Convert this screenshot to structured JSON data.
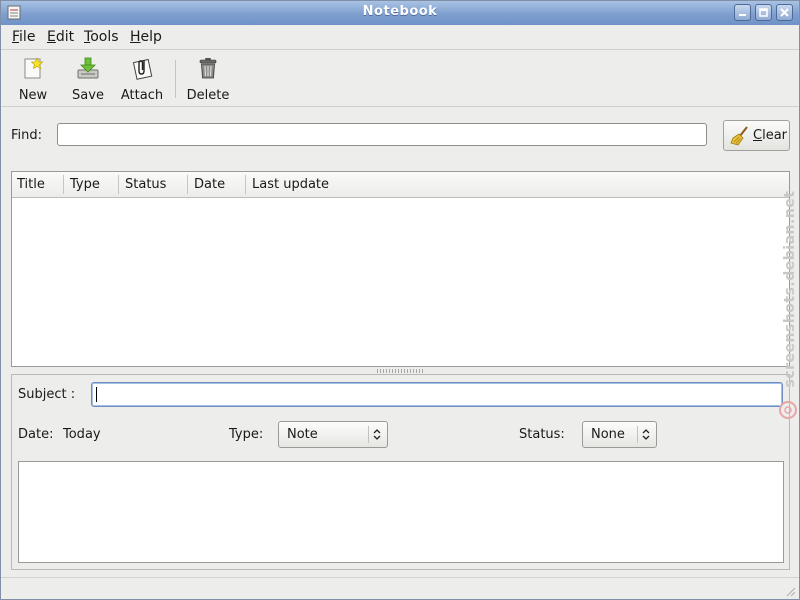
{
  "window": {
    "title": "Notebook",
    "icons": {
      "app": "notebook-app-icon",
      "minimize": "minimize-icon",
      "maximize": "maximize-icon",
      "close": "close-icon"
    }
  },
  "menu": {
    "file": {
      "mnemonic": "F",
      "rest": "ile"
    },
    "edit": {
      "mnemonic": "E",
      "rest": "dit"
    },
    "tools": {
      "mnemonic": "T",
      "rest": "ools"
    },
    "help": {
      "mnemonic": "H",
      "rest": "elp"
    }
  },
  "toolbar": {
    "new_label": "New",
    "save_label": "Save",
    "attach_label": "Attach",
    "delete_label": "Delete",
    "icons": {
      "new": "new-note-icon",
      "save": "save-icon",
      "attach": "paperclip-icon",
      "delete": "trash-icon"
    }
  },
  "find": {
    "label": "Find:",
    "value": "",
    "clear_mnemonic": "C",
    "clear_rest": "lear",
    "clear_icon": "broom-icon"
  },
  "list": {
    "columns": [
      "Title",
      "Type",
      "Status",
      "Date",
      "Last update"
    ],
    "rows": []
  },
  "detail": {
    "subject_label": "Subject :",
    "subject_value": "",
    "date_label": "Date:",
    "date_value": "Today",
    "type_label": "Type:",
    "type_value": "Note",
    "status_label": "Status:",
    "status_value": "None",
    "body_text": ""
  },
  "watermark": "screenshots.debian.net",
  "colors": {
    "titlebar": "#7e9fcf",
    "focus_border": "#6d8ec2",
    "background": "#ededeb"
  }
}
